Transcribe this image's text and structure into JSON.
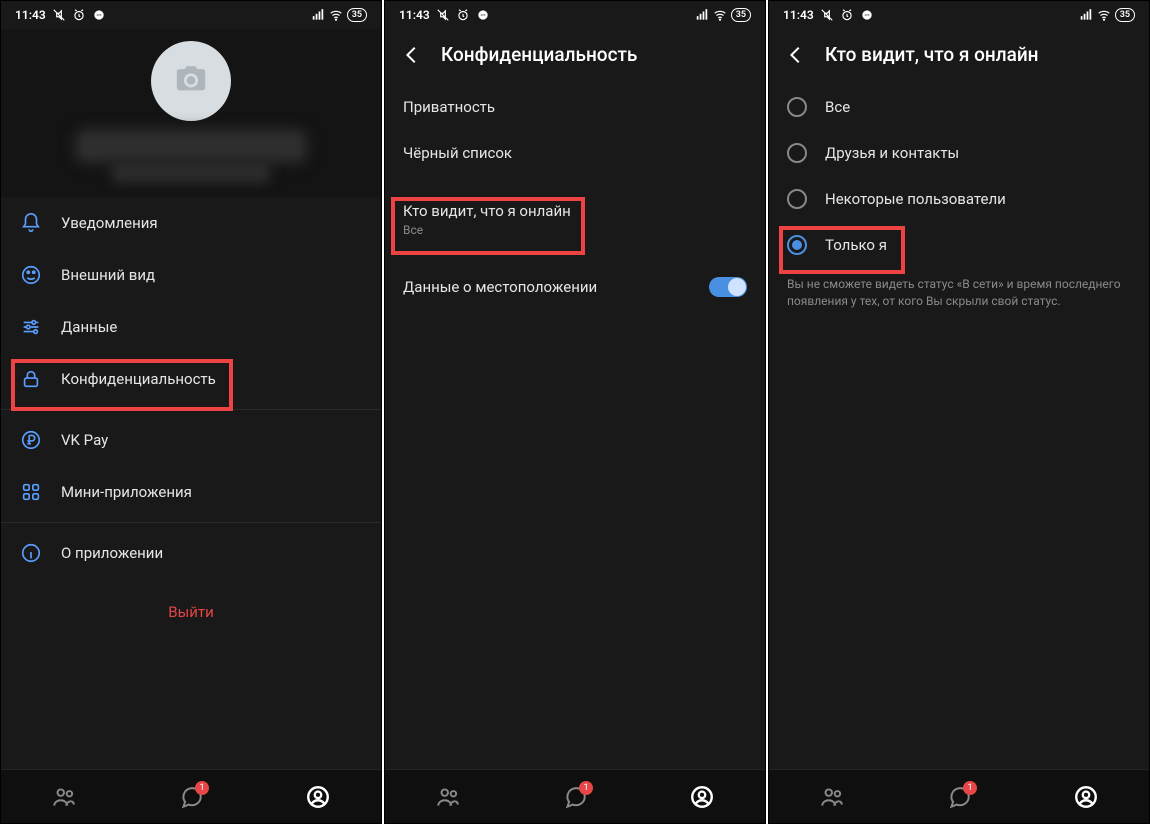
{
  "status": {
    "time": "11:43",
    "battery": "35"
  },
  "screen1": {
    "menu": {
      "notifications": "Уведомления",
      "appearance": "Внешний вид",
      "data": "Данные",
      "privacy": "Конфиденциальность",
      "vkpay": "VK Pay",
      "miniapps": "Мини-приложения",
      "about": "О приложении"
    },
    "logout": "Выйти"
  },
  "screen2": {
    "title": "Конфиденциальность",
    "rows": {
      "privacy": "Приватность",
      "blacklist": "Чёрный список",
      "online_title": "Кто видит, что я онлайн",
      "online_sub": "Все",
      "location": "Данные о местоположении"
    }
  },
  "screen3": {
    "title": "Кто видит, что я онлайн",
    "options": {
      "all": "Все",
      "friends": "Друзья и контакты",
      "some": "Некоторые пользователи",
      "me": "Только я"
    },
    "hint": "Вы не сможете видеть статус «В сети» и время последнего появления у тех, от кого Вы скрыли свой статус."
  },
  "nav": {
    "badge": "1"
  }
}
